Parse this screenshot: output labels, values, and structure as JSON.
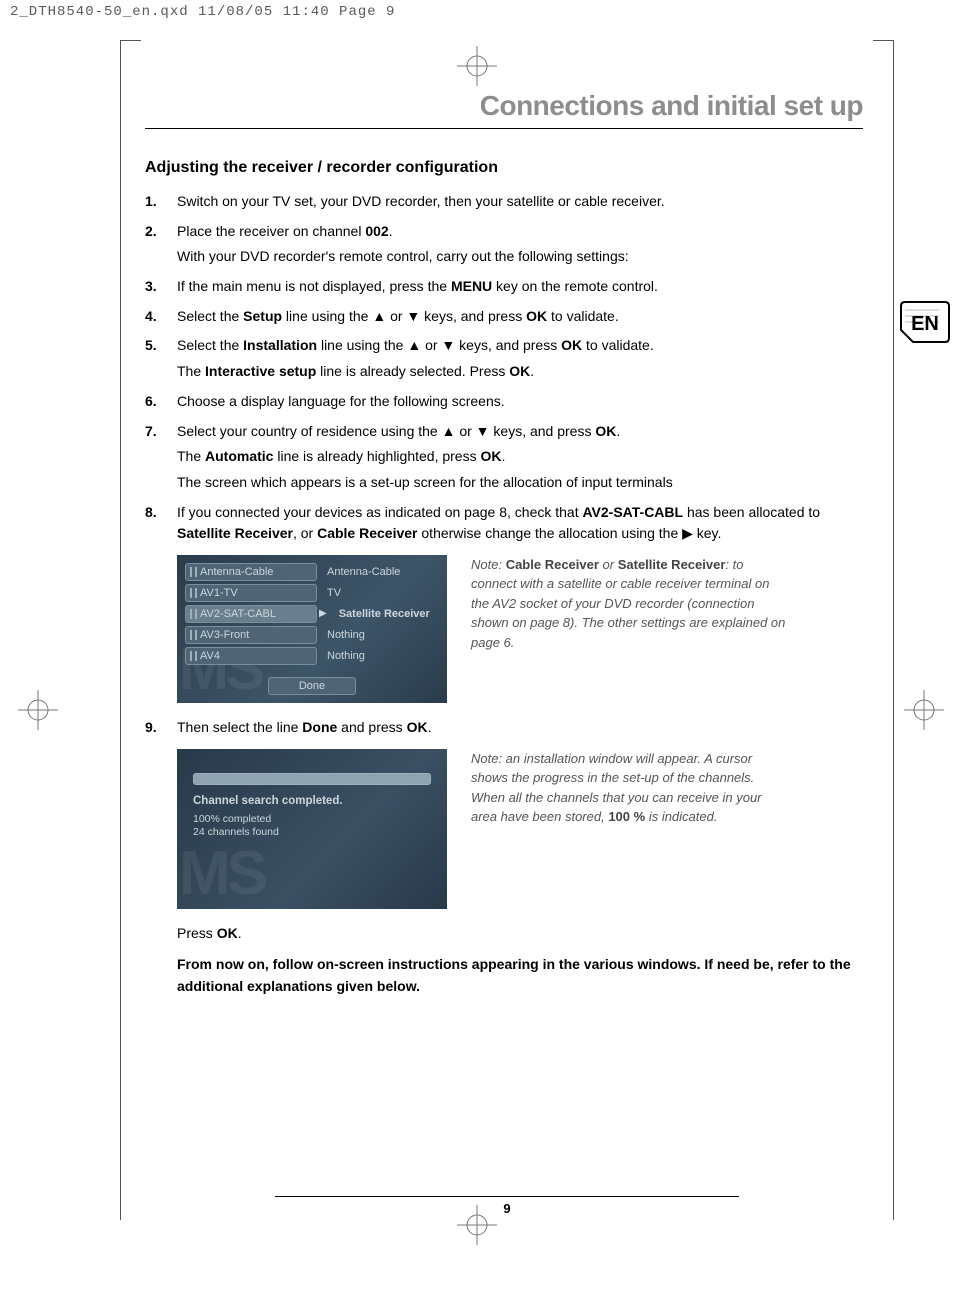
{
  "slug": "2_DTH8540-50_en.qxd  11/08/05  11:40  Page 9",
  "lang_badge": "EN",
  "chapter_title": "Connections and initial set up",
  "section_title": "Adjusting the receiver / recorder configuration",
  "steps": {
    "s1": "Switch on your TV set, your DVD recorder, then your satellite or cable receiver.",
    "s2a": "Place the receiver on channel ",
    "s2b": "002",
    "s2c": ".",
    "s2d": "With your DVD recorder's remote control, carry out the following settings:",
    "s3a": "If the main menu is not displayed, press the ",
    "s3b": "MENU",
    "s3c": " key on the remote control.",
    "s4a": "Select the ",
    "s4b": "Setup",
    "s4c": " line using the ▲ or ▼ keys, and press ",
    "s4d": "OK",
    "s4e": " to validate.",
    "s5a": "Select the ",
    "s5b": "Installation",
    "s5c": " line using the ▲ or ▼ keys, and press ",
    "s5d": "OK",
    "s5e": " to validate.",
    "s5f": "The ",
    "s5g": "Interactive setup",
    "s5h": " line is already selected. Press ",
    "s5i": "OK",
    "s5j": ".",
    "s6": "Choose a display language for the following screens.",
    "s7a": "Select your country of residence using the ▲ or ▼ keys, and press ",
    "s7b": "OK",
    "s7c": ".",
    "s7d": "The ",
    "s7e": "Automatic",
    "s7f": " line is already highlighted, press ",
    "s7g": "OK",
    "s7h": ".",
    "s7i": "The screen which appears is a set-up screen for the allocation of input terminals",
    "s8a": "If you connected your devices as indicated on page 8, check that ",
    "s8b": "AV2-SAT-CABL",
    "s8c": " has been allocated to ",
    "s8d": "Satellite Receiver",
    "s8e": ", or ",
    "s8f": "Cable Receiver",
    "s8g": " otherwise change the allocation using the ▶ key.",
    "s9a": "Then select the line ",
    "s9b": "Done",
    "s9c": " and press ",
    "s9d": "OK",
    "s9e": "."
  },
  "shot1": {
    "rows": [
      {
        "label": "Antenna-Cable",
        "value": "Antenna-Cable",
        "sel": false
      },
      {
        "label": "AV1-TV",
        "value": "TV",
        "sel": false
      },
      {
        "label": "AV2-SAT-CABL",
        "value": "Satellite Receiver",
        "sel": true
      },
      {
        "label": "AV3-Front",
        "value": "Nothing",
        "sel": false
      },
      {
        "label": "AV4",
        "value": "Nothing",
        "sel": false
      }
    ],
    "done": "Done"
  },
  "note1": {
    "prefix": "Note: ",
    "b1": "Cable Receiver",
    "mid1": " or ",
    "b2": "Satellite Receiver",
    "rest": ": to connect with a satellite or cable receiver terminal on the AV2 socket of your DVD recorder (connection shown on page 8). The other settings are explained on page 6."
  },
  "shot2": {
    "msg": "Channel search completed.",
    "sub1": "100% completed",
    "sub2": "24 channels found"
  },
  "note2": {
    "prefix": "Note: an installation window will appear. A cursor shows the progress in the set-up of the channels. When all the channels that you can receive in your area have been stored, ",
    "b1": "100 %",
    "rest": " is indicated."
  },
  "press_ok_a": "Press ",
  "press_ok_b": "OK",
  "press_ok_c": ".",
  "closing": "From now on, follow on-screen instructions appearing in the various windows. If need be, refer to the additional explanations given below.",
  "page_number": "9"
}
